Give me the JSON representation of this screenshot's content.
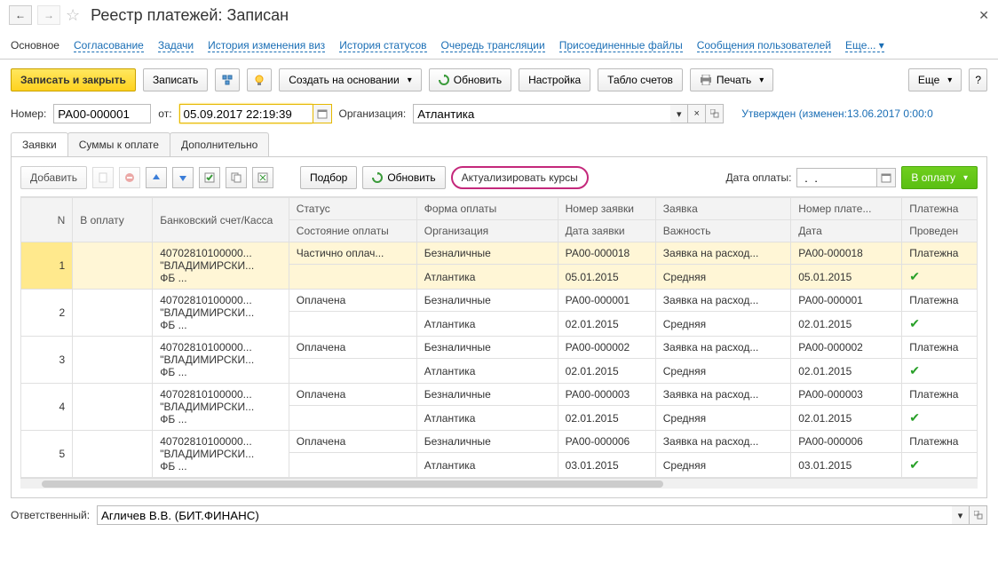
{
  "header": {
    "title": "Реестр платежей: Записан"
  },
  "nav": {
    "main": "Основное",
    "links": [
      "Согласование",
      "Задачи",
      "История изменения виз",
      "История статусов",
      "Очередь трансляции",
      "Присоединенные файлы",
      "Сообщения пользователей"
    ],
    "more": "Еще..."
  },
  "toolbar": {
    "saveClose": "Записать и закрыть",
    "save": "Записать",
    "createBase": "Создать на основании",
    "refresh": "Обновить",
    "settings": "Настройка",
    "accountBoard": "Табло счетов",
    "print": "Печать",
    "more": "Еще",
    "help": "?"
  },
  "fields": {
    "numberLabel": "Номер:",
    "numberValue": "РА00-000001",
    "fromLabel": "от:",
    "dateValue": "05.09.2017 22:19:39",
    "orgLabel": "Организация:",
    "orgValue": "Атлантика",
    "statusText": "Утвержден (изменен:13.06.2017 0:00:0"
  },
  "subTabs": [
    "Заявки",
    "Суммы к оплате",
    "Дополнительно"
  ],
  "innerBar": {
    "add": "Добавить",
    "pick": "Подбор",
    "refresh": "Обновить",
    "actualize": "Актуализировать курсы",
    "payDateLabel": "Дата оплаты:",
    "payDateValue": " .  .    ",
    "toPay": "В оплату"
  },
  "columns": {
    "n": "N",
    "toPay": "В оплату",
    "bank": "Банковский счет/Касса",
    "status": "Статус",
    "payState": "Состояние оплаты",
    "payForm": "Форма оплаты",
    "org": "Организация",
    "reqNum": "Номер заявки",
    "reqDate": "Дата заявки",
    "order": "Заявка",
    "importance": "Важность",
    "docNum": "Номер плате...",
    "date": "Дата",
    "docType": "Платежна",
    "posted": "Проведен"
  },
  "rows": [
    {
      "n": "1",
      "bank": "40702810100000...\n\"ВЛАДИМИРСКИ...\nФБ ...",
      "status": "Частично оплач...",
      "form": "Безналичные",
      "org": "Атлантика",
      "reqNum": "РА00-000018",
      "reqDate": "05.01.2015",
      "order": "Заявка на расход...",
      "imp": "Средняя",
      "docNum": "РА00-000018",
      "date": "05.01.2015",
      "docType": "Платежна",
      "posted": true,
      "selected": true
    },
    {
      "n": "2",
      "bank": "40702810100000...\n\"ВЛАДИМИРСКИ...\nФБ ...",
      "status": "Оплачена",
      "form": "Безналичные",
      "org": "Атлантика",
      "reqNum": "РА00-000001",
      "reqDate": "02.01.2015",
      "order": "Заявка на расход...",
      "imp": "Средняя",
      "docNum": "РА00-000001",
      "date": "02.01.2015",
      "docType": "Платежна",
      "posted": true
    },
    {
      "n": "3",
      "bank": "40702810100000...\n\"ВЛАДИМИРСКИ...\nФБ ...",
      "status": "Оплачена",
      "form": "Безналичные",
      "org": "Атлантика",
      "reqNum": "РА00-000002",
      "reqDate": "02.01.2015",
      "order": "Заявка на расход...",
      "imp": "Средняя",
      "docNum": "РА00-000002",
      "date": "02.01.2015",
      "docType": "Платежна",
      "posted": true
    },
    {
      "n": "4",
      "bank": "40702810100000...\n\"ВЛАДИМИРСКИ...\nФБ ...",
      "status": "Оплачена",
      "form": "Безналичные",
      "org": "Атлантика",
      "reqNum": "РА00-000003",
      "reqDate": "02.01.2015",
      "order": "Заявка на расход...",
      "imp": "Средняя",
      "docNum": "РА00-000003",
      "date": "02.01.2015",
      "docType": "Платежна",
      "posted": true
    },
    {
      "n": "5",
      "bank": "40702810100000...\n\"ВЛАДИМИРСКИ...\nФБ ...",
      "status": "Оплачена",
      "form": "Безналичные",
      "org": "Атлантика",
      "reqNum": "РА00-000006",
      "reqDate": "03.01.2015",
      "order": "Заявка на расход...",
      "imp": "Средняя",
      "docNum": "РА00-000006",
      "date": "03.01.2015",
      "docType": "Платежна",
      "posted": true
    }
  ],
  "footer": {
    "respLabel": "Ответственный:",
    "respValue": "Агличев В.В. (БИТ.ФИНАНС)"
  }
}
